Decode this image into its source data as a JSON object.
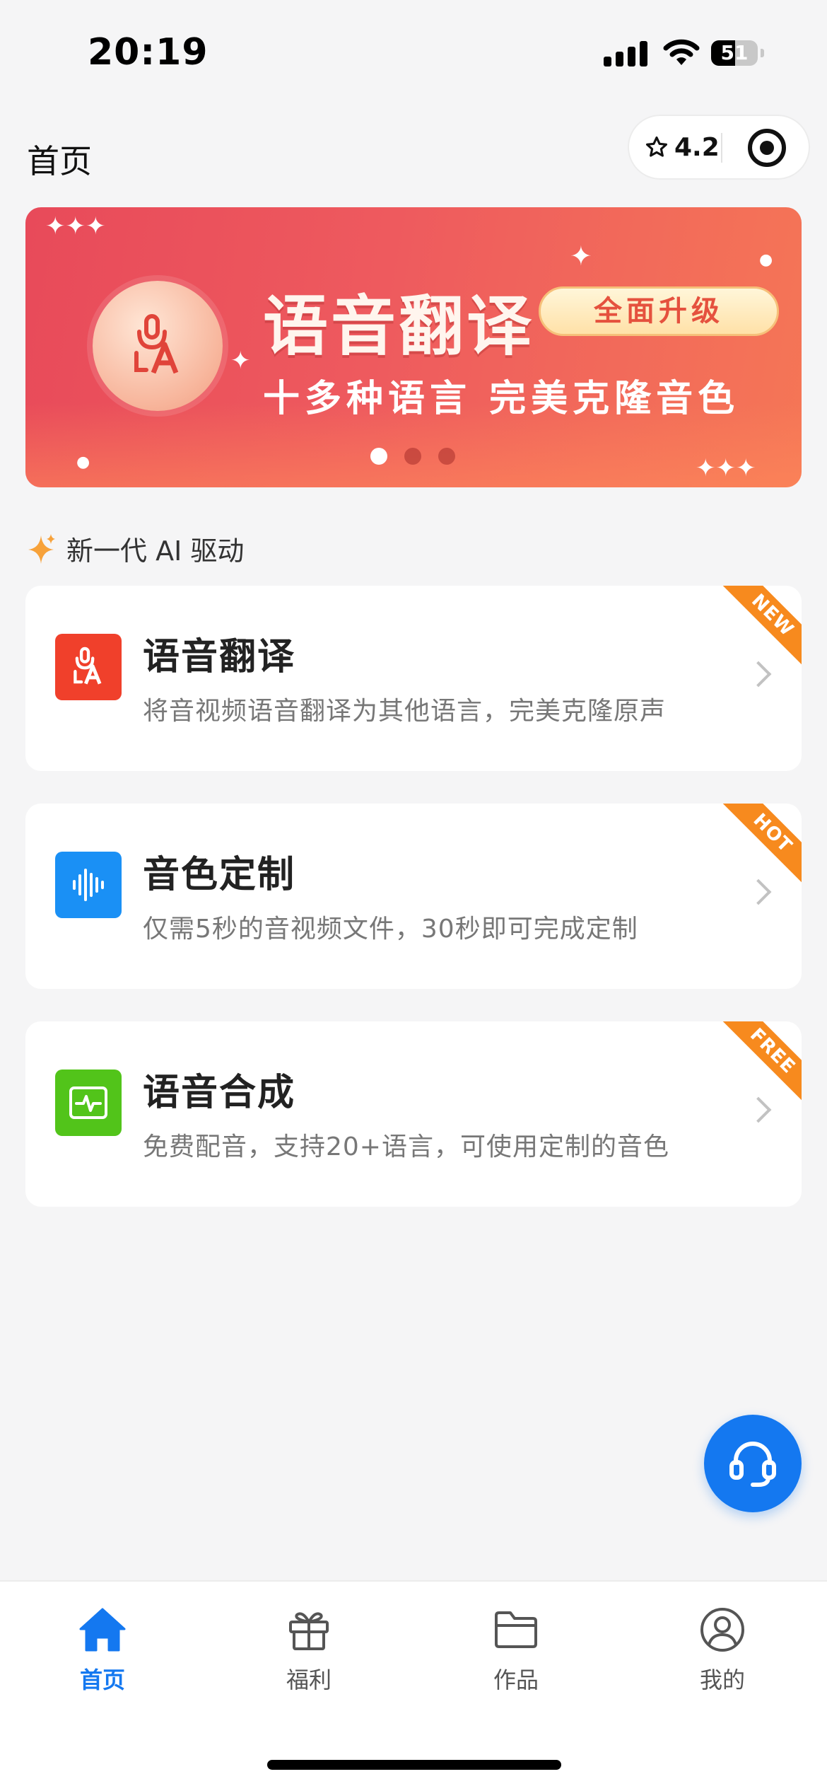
{
  "status_bar": {
    "time": "20:19",
    "battery": "51",
    "battery_level": 0.51
  },
  "header": {
    "title": "首页",
    "rating": "4.2",
    "rating_icon": "star-outline-icon",
    "target_icon": "target-icon"
  },
  "banner": {
    "title": "语音翻译",
    "badge": "全面升级",
    "subtitle": "十多种语言 完美克隆音色",
    "icon": "microphone-translate-icon",
    "slide_count": 3,
    "active_slide": 1
  },
  "section": {
    "label": "新一代 AI 驱动",
    "icon": "sparkle-icon"
  },
  "features": [
    {
      "title": "语音翻译",
      "description": "将音视频语音翻译为其他语言，完美克隆原声",
      "tag": "NEW",
      "icon": "microphone-translate-icon",
      "icon_color": "#f0402b"
    },
    {
      "title": "音色定制",
      "description": "仅需5秒的音视频文件，30秒即可完成定制",
      "tag": "HOT",
      "icon": "waveform-icon",
      "icon_color": "#1a90f5"
    },
    {
      "title": "语音合成",
      "description": "免费配音，支持20+语言，可使用定制的音色",
      "tag": "FREE",
      "icon": "pulse-monitor-icon",
      "icon_color": "#52c41a"
    }
  ],
  "support_button": {
    "icon": "headset-icon"
  },
  "tab_bar": {
    "active": "首页",
    "active_color": "#1478f0",
    "tabs": [
      {
        "label": "首页",
        "icon": "home-icon"
      },
      {
        "label": "福利",
        "icon": "gift-icon"
      },
      {
        "label": "作品",
        "icon": "folder-icon"
      },
      {
        "label": "我的",
        "icon": "user-icon"
      }
    ]
  }
}
